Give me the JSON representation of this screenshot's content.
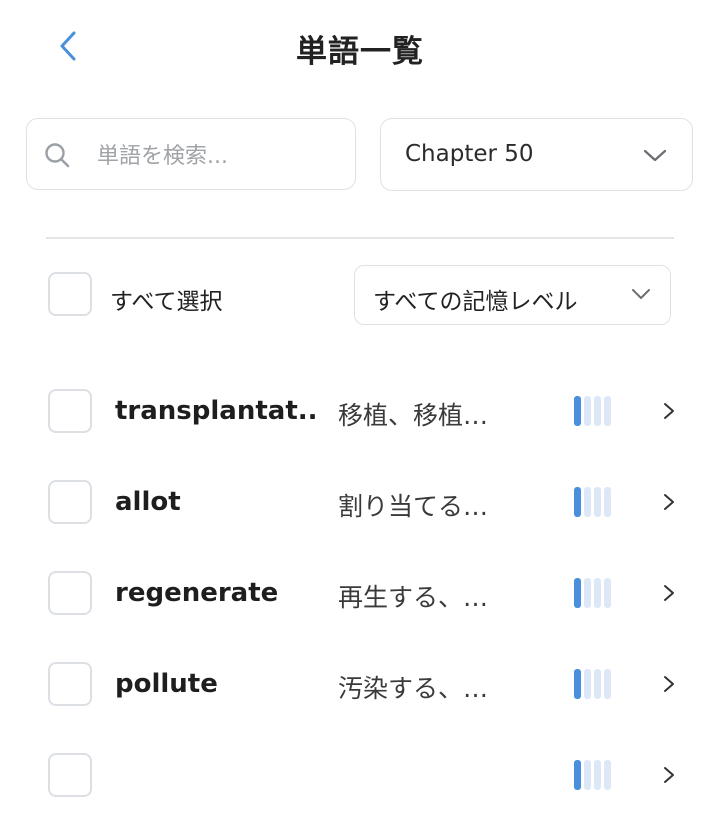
{
  "header": {
    "title": "単語一覧",
    "back_icon": "chevron-left-icon"
  },
  "search": {
    "placeholder": "単語を検索...",
    "value": ""
  },
  "chapter_select": {
    "selected": "Chapter 50"
  },
  "select_all": {
    "label": "すべて選択",
    "checked": false
  },
  "level_filter": {
    "selected": "すべての記憶レベル"
  },
  "colors": {
    "accent": "#4a8fdc",
    "level_bar_inactive": "#dce8f7",
    "border": "#dfe1e5"
  },
  "words": [
    {
      "word": "transplantat...",
      "meaning": "移植、移植…",
      "level": 1,
      "max_level": 4
    },
    {
      "word": "allot",
      "meaning": "割り当てる…",
      "level": 1,
      "max_level": 4
    },
    {
      "word": "regenerate",
      "meaning": "再生する、…",
      "level": 1,
      "max_level": 4
    },
    {
      "word": "pollute",
      "meaning": "汚染する、…",
      "level": 1,
      "max_level": 4
    },
    {
      "word": "",
      "meaning": "",
      "level": 1,
      "max_level": 4
    }
  ]
}
